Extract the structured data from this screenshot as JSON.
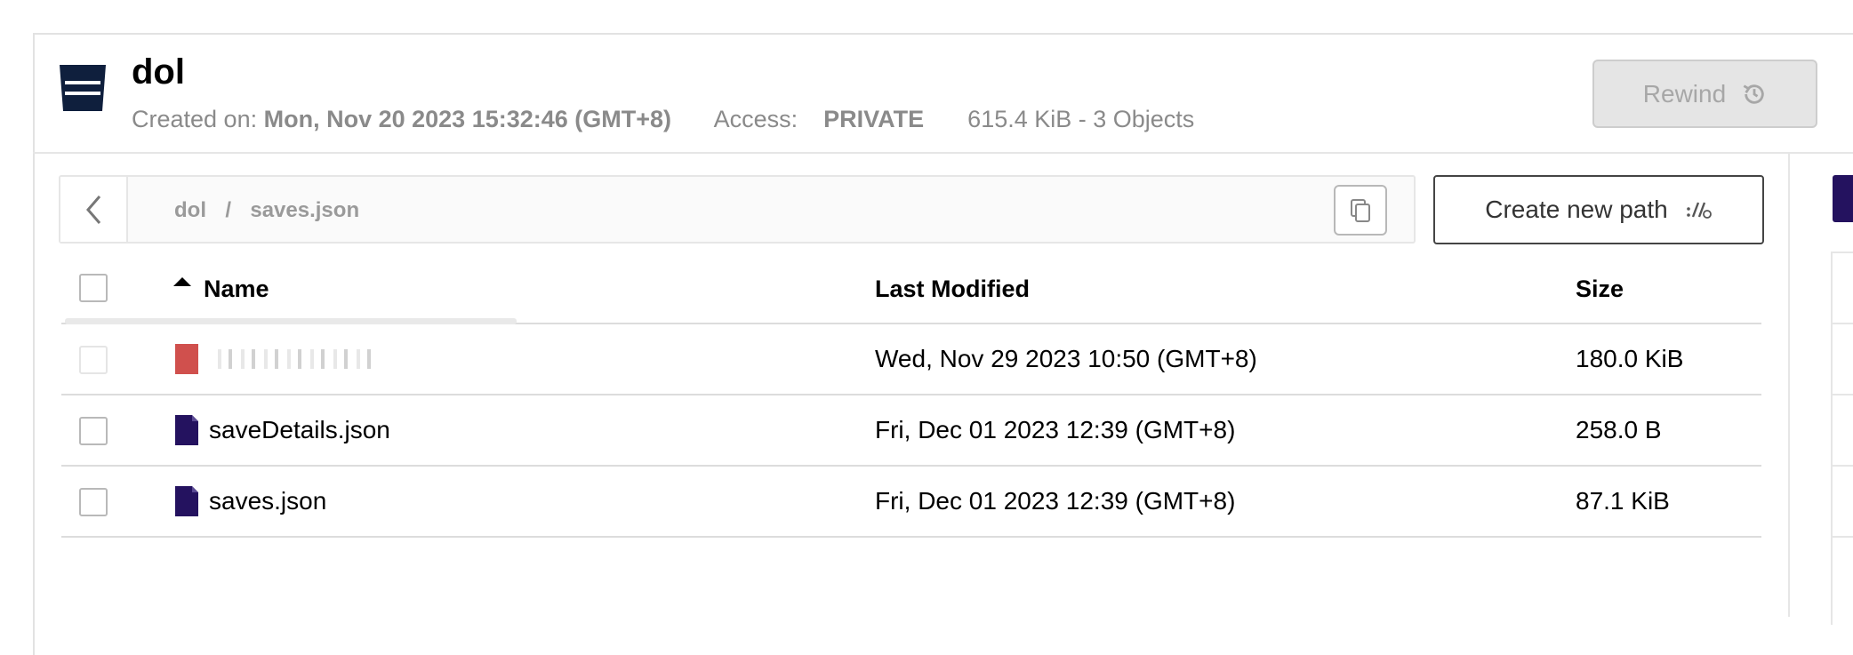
{
  "bucket": {
    "name": "dol",
    "created_label": "Created on:",
    "created_value": "Mon, Nov 20 2023 15:32:46 (GMT+8)",
    "access_label": "Access:",
    "access_value": "PRIVATE",
    "usage": "615.4 KiB - 3 Objects",
    "icon": "bucket-icon"
  },
  "toolbar": {
    "rewind_label": "Rewind",
    "rewind_icon": "history-icon"
  },
  "path_bar": {
    "root": "dol",
    "separator": "/",
    "current": "saves.json",
    "back_icon": "chevron-left-icon",
    "copy_icon": "copy-icon"
  },
  "create_path": {
    "label": "Create new path",
    "icon": "new-path-icon"
  },
  "table": {
    "columns": [
      "Name",
      "Last Modified",
      "Size"
    ],
    "rows": [
      {
        "name": "",
        "modified": "Wed, Nov 29 2023 10:50 (GMT+8)",
        "size": "180.0 KiB",
        "icon_color": "#d0504d"
      },
      {
        "name": "saveDetails.json",
        "modified": "Fri, Dec 01 2023 12:39 (GMT+8)",
        "size": "258.0 B",
        "icon_color": "#24125f"
      },
      {
        "name": "saves.json",
        "modified": "Fri, Dec 01 2023 12:39 (GMT+8)",
        "size": "87.1 KiB",
        "icon_color": "#24125f"
      }
    ]
  },
  "colors": {
    "brand": "#0f1f3d",
    "accent": "#24125f",
    "object_icon": "#24125f"
  }
}
